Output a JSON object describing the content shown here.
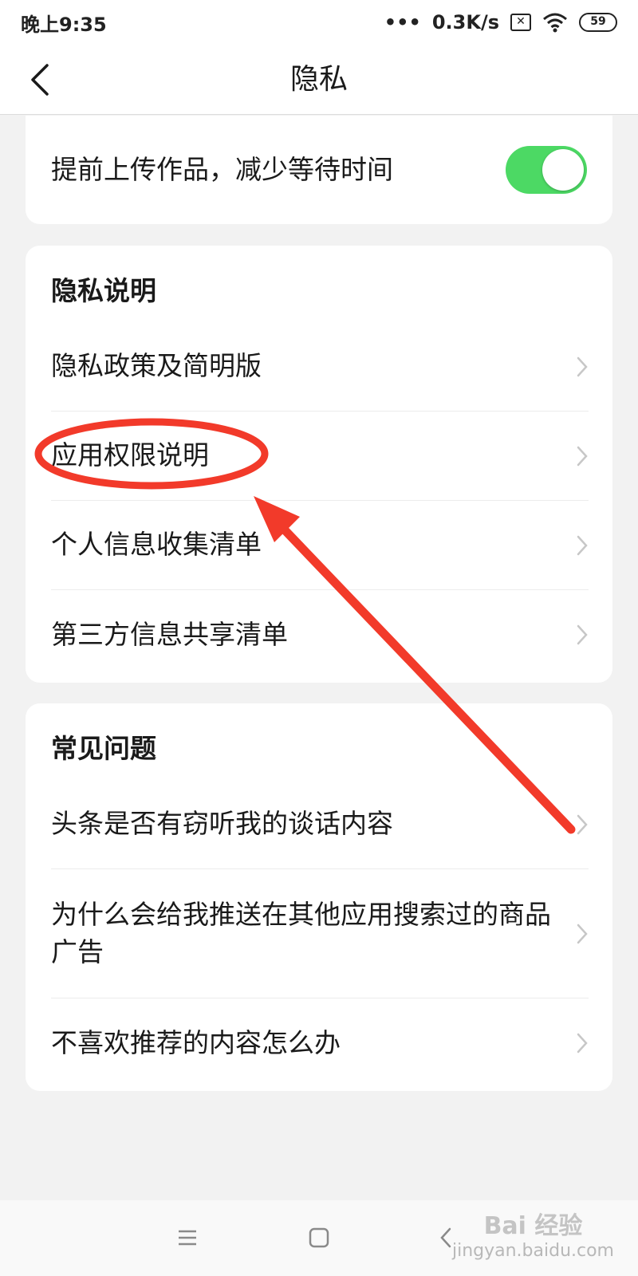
{
  "status_bar": {
    "time": "晚上9:35",
    "network_speed": "0.3K/s",
    "dots": "•••",
    "sim": "✕",
    "battery": "59"
  },
  "header": {
    "title": "隐私",
    "back_icon": "chevron-left-icon"
  },
  "upload_setting": {
    "label": "提前上传作品，减少等待时间",
    "enabled": true,
    "toggle_color": "#4cd964"
  },
  "privacy_section": {
    "title": "隐私说明",
    "items": [
      {
        "label": "隐私政策及简明版"
      },
      {
        "label": "应用权限说明"
      },
      {
        "label": "个人信息收集清单"
      },
      {
        "label": "第三方信息共享清单"
      }
    ]
  },
  "faq_section": {
    "title": "常见问题",
    "items": [
      {
        "label": "头条是否有窃听我的谈话内容"
      },
      {
        "label": "为什么会给我推送在其他应用搜索过的商品广告"
      },
      {
        "label": "不喜欢推荐的内容怎么办"
      }
    ]
  },
  "nav_bar": {
    "menu_icon": "menu-icon",
    "home_icon": "square-icon",
    "back_icon": "back-triangle-icon"
  },
  "watermark": {
    "main": "Bai 经验",
    "sub": "jingyan.baidu.com"
  },
  "annotation_color": "#f23a2a"
}
